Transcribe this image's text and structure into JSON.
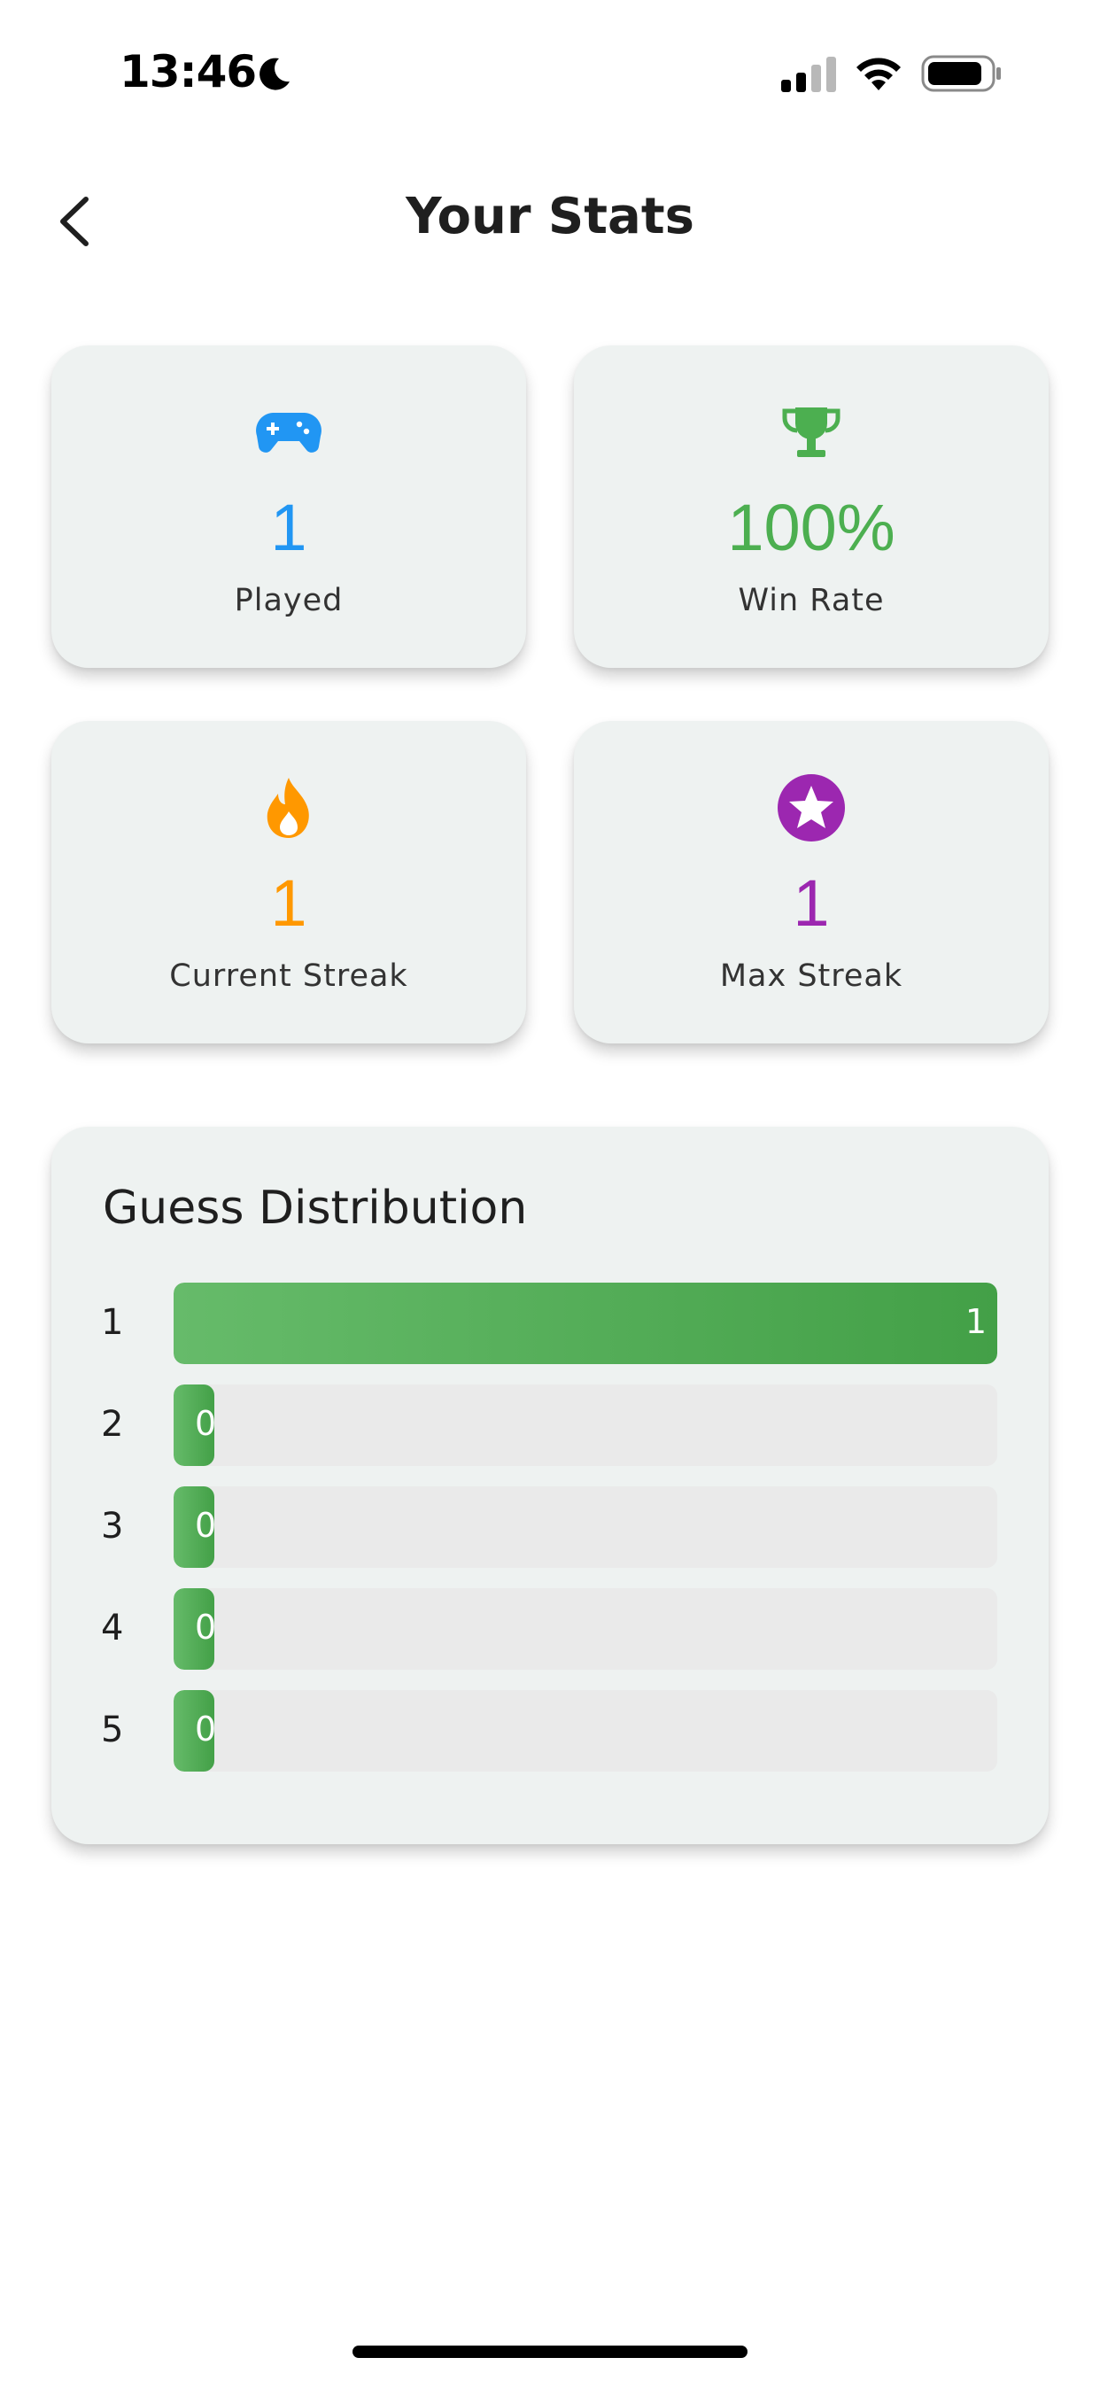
{
  "status_bar": {
    "time": "13:46",
    "icons": [
      "moon-icon",
      "cellular-signal-icon",
      "wifi-icon",
      "battery-icon"
    ]
  },
  "header": {
    "title": "Your Stats",
    "back_icon": "chevron-left-icon"
  },
  "stats": {
    "played": {
      "value": "1",
      "label": "Played",
      "icon": "gamepad-icon",
      "color": "#2196f3"
    },
    "win_rate": {
      "value": "100%",
      "label": "Win Rate",
      "icon": "trophy-icon",
      "color": "#4caf50"
    },
    "current_streak": {
      "value": "1",
      "label": "Current Streak",
      "icon": "flame-icon",
      "color": "#ff9800"
    },
    "max_streak": {
      "value": "1",
      "label": "Max Streak",
      "icon": "star-icon",
      "color": "#9c27b0"
    }
  },
  "distribution": {
    "title": "Guess Distribution",
    "bar_color": "#4caf50",
    "rows": [
      {
        "guess": "1",
        "count": "1",
        "fraction": 1.0
      },
      {
        "guess": "2",
        "count": "0",
        "fraction": 0
      },
      {
        "guess": "3",
        "count": "0",
        "fraction": 0
      },
      {
        "guess": "4",
        "count": "0",
        "fraction": 0
      },
      {
        "guess": "5",
        "count": "0",
        "fraction": 0
      }
    ]
  }
}
